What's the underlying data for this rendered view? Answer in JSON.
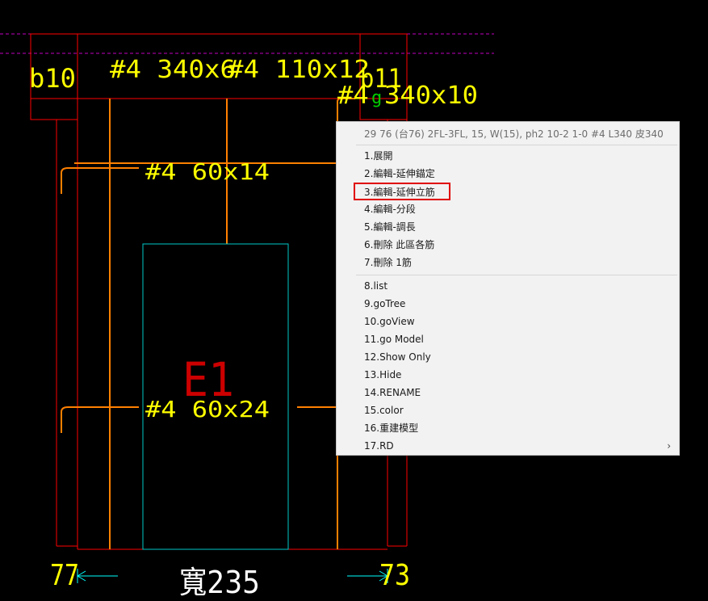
{
  "drawing": {
    "labels": {
      "b10": "b10",
      "b11": "b11",
      "g": "g",
      "top_rebar_1": "#4 340x6",
      "top_rebar_2": "#4 110x12",
      "top_rebar_3": "#4 340x10",
      "mid_rebar": "#4 60x14",
      "bottom_rebar": "#4 60x24",
      "element_id": "E1",
      "width_label": "寬235",
      "left_dim": "77",
      "right_dim": "73"
    },
    "colors": {
      "outline": "#ff0000",
      "rebar": "#ff8000",
      "text": "#ffff00",
      "dimension": "#00ffff",
      "green_text": "#00cc00",
      "dashed_line": "#c000c0",
      "opening": "#00c8c8"
    }
  },
  "context_menu": {
    "header": "29 76 (台76) 2FL-3FL, 15, W(15), ph2 10-2 1-0 #4 L340 皮340",
    "group1": [
      "1.展開",
      "2.編輯-延伸錨定",
      "3.編輯-延伸立筋",
      "4.編輯-分段",
      "5.編輯-調長",
      "6.刪除 此區各筋",
      "7.刪除 1筋"
    ],
    "group2": [
      "8.list",
      "9.goTree",
      "10.goView",
      "11.go Model",
      "12.Show Only",
      "13.Hide",
      "14.RENAME",
      "15.color",
      "16.重建模型",
      "17.RD"
    ],
    "submenu_arrow": "›",
    "highlighted_item": "3.編輯-延伸立筋"
  }
}
